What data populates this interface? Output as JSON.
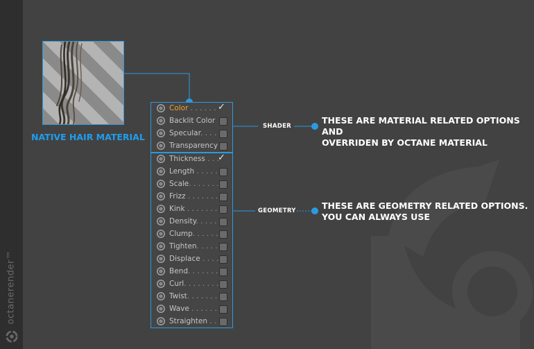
{
  "brand": {
    "text": "octanerender™",
    "icon": "octane-logo-icon"
  },
  "material": {
    "caption": "NATIVE HAIR MATERIAL"
  },
  "shader_panel": {
    "tag": "SHADER",
    "note_line1": "THESE ARE MATERIAL RELATED OPTIONS AND",
    "note_line2": "OVERRIDEN BY OCTANE MATERIAL",
    "items": [
      {
        "label": "Color",
        "dots": " . . . . . .",
        "checked": true
      },
      {
        "label": "Backlit Color",
        "dots": "",
        "checked": false
      },
      {
        "label": "Specular",
        "dots": ". . . .",
        "checked": false
      },
      {
        "label": "Transparency",
        "dots": "",
        "checked": false
      }
    ]
  },
  "geometry_panel": {
    "tag": "GEOMETRY",
    "note_line1": "THESE ARE GEOMETRY RELATED OPTIONS.",
    "note_line2": "YOU CAN ALWAYS USE",
    "items": [
      {
        "label": "Thickness",
        "dots": " . . .",
        "checked": true
      },
      {
        "label": "Length",
        "dots": " . . . . .",
        "checked": false
      },
      {
        "label": "Scale",
        "dots": ". . . . . . .",
        "checked": false
      },
      {
        "label": "Frizz",
        "dots": " . . . . . . .",
        "checked": false
      },
      {
        "label": "Kink",
        "dots": " . . . . . . .",
        "checked": false
      },
      {
        "label": "Density",
        "dots": ". . . . .",
        "checked": false
      },
      {
        "label": "Clump",
        "dots": ". . . . . .",
        "checked": false
      },
      {
        "label": "Tighten",
        "dots": ". . . . .",
        "checked": false
      },
      {
        "label": "Displace",
        "dots": " . . . .",
        "checked": false
      },
      {
        "label": "Bend",
        "dots": ". . . . . . .",
        "checked": false
      },
      {
        "label": "Curl",
        "dots": ". . . . . . . .",
        "checked": false
      },
      {
        "label": "Twist",
        "dots": ". . . . . . .",
        "checked": false
      },
      {
        "label": "Wave",
        "dots": " . . . . . .",
        "checked": false
      },
      {
        "label": "Straighten",
        "dots": " . .",
        "checked": false
      }
    ]
  },
  "colors": {
    "accent": "#2b9be0",
    "active": "#f0a030"
  }
}
